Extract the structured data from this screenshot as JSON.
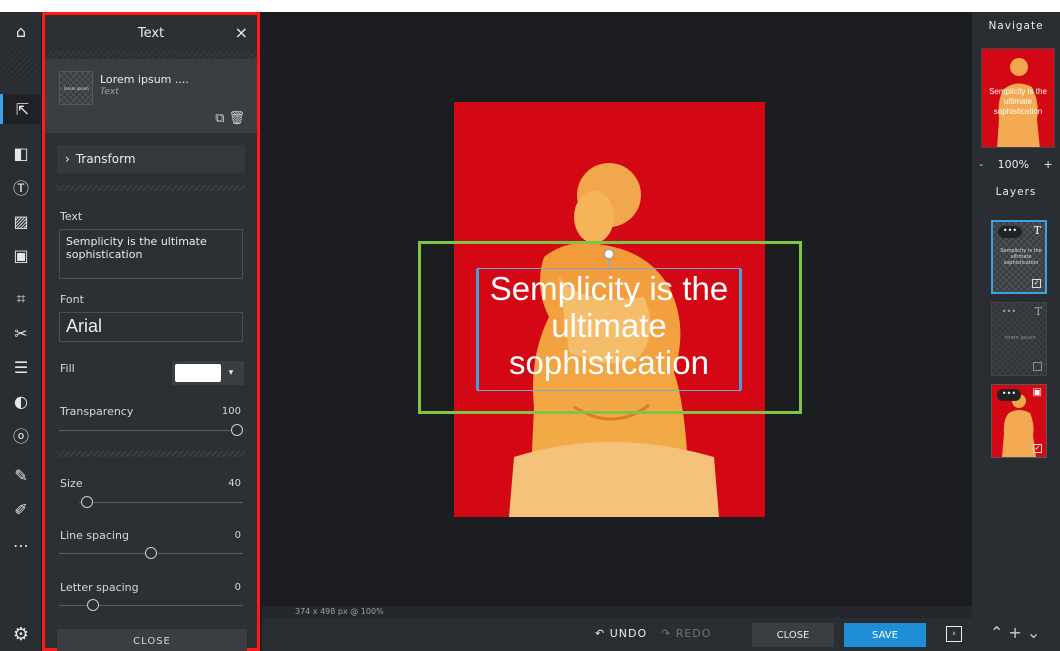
{
  "panel": {
    "title": "Text",
    "close_icon": "×",
    "layer": {
      "name": "Lorem ipsum ....",
      "type": "Text",
      "mini_text": "lorem ipsum"
    },
    "transform_label": "Transform",
    "text_label": "Text",
    "text_value": "Semplicity is the ultimate sophistication",
    "font_label": "Font",
    "font_value": "Arial",
    "fill_label": "Fill",
    "fill_color": "#ffffff",
    "transparency_label": "Transparency",
    "transparency_value": "100",
    "size_label": "Size",
    "size_value": "40",
    "line_spacing_label": "Line spacing",
    "line_spacing_value": "0",
    "letter_spacing_label": "Letter spacing",
    "letter_spacing_value": "0",
    "close_label": "CLOSE"
  },
  "rail": {
    "tools": [
      "home-icon",
      "pointer-icon",
      "layout-icon",
      "text-tool-icon",
      "texture-icon",
      "image-icon",
      "crop-icon",
      "cut-icon",
      "adjust-icon",
      "contrast-icon",
      "spiral-icon",
      "bandage-icon",
      "brush-icon",
      "more-icon"
    ],
    "settings_icon": "gear-icon"
  },
  "canvas": {
    "overlay_text": "Semplicity is the ultimate sophistication",
    "status": "374 x 498 px @ 100%",
    "background_color": "#d40814"
  },
  "right": {
    "navigate_title": "Navigate",
    "nav_text": "Semplicity is the ultimate sophistication",
    "zoom_minus": "-",
    "zoom_value": "100%",
    "zoom_plus": "+",
    "layers_title": "Layers",
    "layer_text_thumb": "Semplicity is the ultimate sophistication",
    "layer_text_thumb2": "lorem ipsum"
  },
  "bottom": {
    "undo_label": "UNDO",
    "redo_label": "REDO",
    "close_label": "CLOSE",
    "save_label": "SAVE"
  },
  "colors": {
    "accent": "#1e8fd6",
    "highlight_red": "#ff1a1a",
    "highlight_green": "#7ec544"
  }
}
